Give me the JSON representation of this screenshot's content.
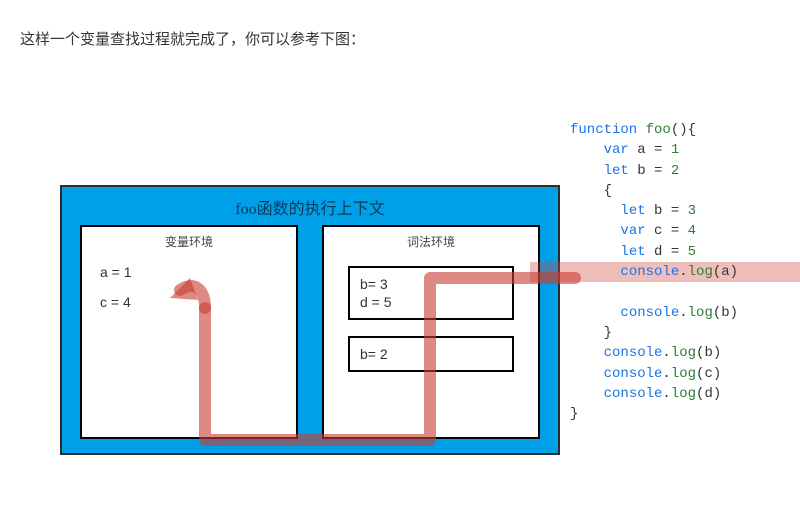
{
  "intro": "这样一个变量查找过程就完成了，你可以参考下图：",
  "diagram": {
    "title": "foo函数的执行上下文",
    "var_env": {
      "title": "变量环境",
      "lines": [
        "a = 1",
        "c = 4"
      ]
    },
    "lex_env": {
      "title": "词法环境",
      "scopes": [
        {
          "lines": [
            "b= 3",
            "d = 5"
          ]
        },
        {
          "lines": [
            "b= 2"
          ]
        }
      ]
    }
  },
  "code": {
    "l1_kw": "function",
    "l1_name": " foo",
    "l1_tail": "(){",
    "l2_kw": "var",
    "l2_mid": " a = ",
    "l2_num": "1",
    "l3_kw": "let",
    "l3_mid": " b = ",
    "l3_num": "2",
    "l4": "{",
    "l5_kw": "let",
    "l5_mid": " b = ",
    "l5_num": "3",
    "l6_kw": "var",
    "l6_mid": " c = ",
    "l6_num": "4",
    "l7_kw": "let",
    "l7_mid": " d = ",
    "l7_num": "5",
    "l8_obj": "console",
    "l8_dot": ".",
    "l8_fn": "log",
    "l8_open": "(",
    "l8_arg": "a",
    "l8_close": ")",
    "l9_obj": "console",
    "l9_fn": "log",
    "l9_arg": "b",
    "l10": "}",
    "l11_obj": "console",
    "l11_fn": "log",
    "l11_arg": "b",
    "l12_obj": "console",
    "l12_fn": "log",
    "l12_arg": "c",
    "l13_obj": "console",
    "l13_fn": "log",
    "l13_arg": "d",
    "l14": "}"
  }
}
